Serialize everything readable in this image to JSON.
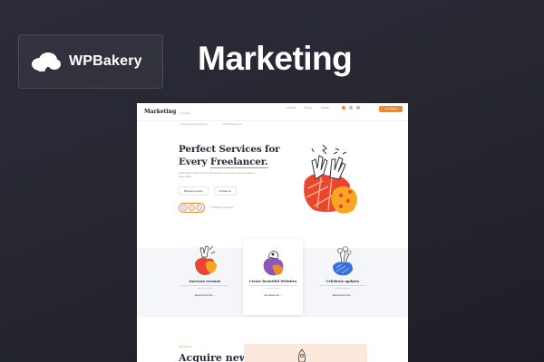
{
  "brand": {
    "badge_label": "WPBakery",
    "cloud_icon": "cloud-logo-icon"
  },
  "headline": "Marketing",
  "colors": {
    "accent_orange": "#f0892c",
    "accent_red": "#e8462e",
    "illus_purple": "#8a58b7",
    "illus_blue": "#3a6fd8",
    "background": "#26252f"
  },
  "preview": {
    "nav": {
      "logo": "Marketing",
      "sub": "Template",
      "links": [
        "Services",
        "Pricing",
        "Contact"
      ],
      "cta": "Get started"
    },
    "bar": [
      "Freelance Marketing Agency",
      "info@marketing.com"
    ],
    "hero": {
      "title_line1": "Perfect Services for",
      "title_line2_prefix": "Every ",
      "title_line2_underlined": "Freelancer.",
      "description": "Nulla facilisi. Vivamus elementum semper nisi, aenean vulputate eleifend tellus cursus.",
      "button_primary": "Request a quote",
      "button_secondary": "Contact us",
      "trusted_text": "Trusted by companies"
    },
    "features": [
      {
        "title": "Increase revenue",
        "description": "Lorem ipsum dolor sit amet consectetur adipiscing elit sed do eiusmod.",
        "link": "Request more info →"
      },
      {
        "title": "Create Beautiful Websites",
        "description": "Lorem ipsum dolor sit amet consectetur adipiscing elit sed do eiusmod.",
        "link": "Get started now →"
      },
      {
        "title": "Celebrate updates",
        "description": "Lorem ipsum dolor sit amet consectetur adipiscing elit sed do eiusmod.",
        "link": "Request more info →"
      }
    ],
    "bottom": {
      "eyebrow": "Our services",
      "title": "Acquire new"
    }
  }
}
